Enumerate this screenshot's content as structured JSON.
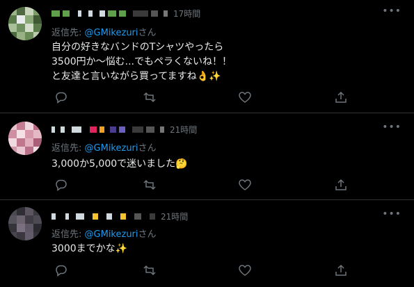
{
  "tweets": [
    {
      "time": "17時間",
      "reply_prefix": "返信先:",
      "reply_handle": "@GMikezuri",
      "reply_suffix": "さん",
      "body_lines": [
        "自分の好きなバンドのTシャツやったら",
        "3500円か〜悩む...でもペラくないね！！",
        "と友達と言いながら買ってますね👌✨"
      ]
    },
    {
      "time": "21時間",
      "reply_prefix": "返信先:",
      "reply_handle": "@GMikezuri",
      "reply_suffix": "さん",
      "body_lines": [
        "3,000か5,000で迷いました🤔"
      ]
    },
    {
      "time": "21時間",
      "reply_prefix": "返信先:",
      "reply_handle": "@GMikezuri",
      "reply_suffix": "さん",
      "body_lines": [
        "3000までかな✨"
      ]
    }
  ],
  "icons": {
    "more": "more-icon",
    "reply": "reply-icon",
    "retweet": "retweet-icon",
    "like": "like-icon",
    "share": "share-icon"
  },
  "colors": {
    "background": "#000000",
    "text": "#e7e9ea",
    "muted": "#6e767d",
    "link": "#1d9bf0",
    "divider": "#2f3336"
  }
}
